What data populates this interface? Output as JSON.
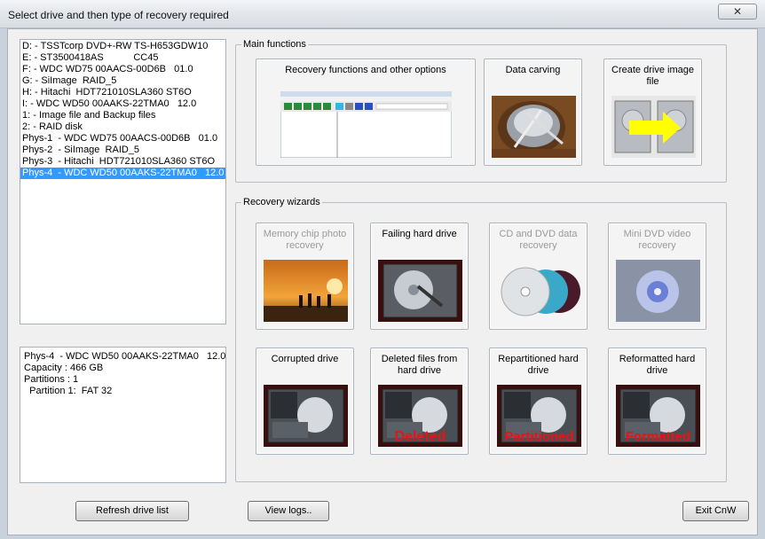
{
  "window": {
    "title": "Select drive and then type of recovery required",
    "close_glyph": "✕"
  },
  "drives": [
    "D: - TSSTcorp DVD+-RW TS-H653GDW10",
    "E: - ST3500418AS           CC45",
    "F: - WDC WD75 00AACS-00D6B   01.0",
    "G: - SiImage  RAID_5",
    "H: - Hitachi  HDT721010SLA360 ST6O",
    "I: - WDC WD50 00AAKS-22TMA0   12.0",
    "1: - Image file and Backup files",
    "2: - RAID disk",
    "Phys-1  - WDC WD75 00AACS-00D6B   01.0",
    "Phys-2  - SiImage  RAID_5",
    "Phys-3  - Hitachi  HDT721010SLA360 ST6O",
    "Phys-4  - WDC WD50 00AAKS-22TMA0   12.0"
  ],
  "selected_drive_index": 11,
  "drive_info": [
    "Phys-4  - WDC WD50 00AAKS-22TMA0   12.0",
    "Capacity : 466 GB",
    "Partitions : 1",
    "  Partition 1:  FAT 32"
  ],
  "main_functions": {
    "label": "Main functions",
    "recovery": "Recovery functions and other options",
    "carving": "Data carving",
    "image": "Create drive image file"
  },
  "wizards": {
    "label": "Recovery wizards",
    "memory": "Memory chip photo recovery",
    "failing": "Failing hard drive",
    "cd": "CD and DVD data recovery",
    "minidvd": "Mini DVD video recovery",
    "corrupted": "Corrupted drive",
    "deleted": "Deleted files from hard drive",
    "repartitioned": "Repartitioned hard drive",
    "reformatted": "Reformatted hard drive",
    "deleted_overlay": "Deleted",
    "partitioned_overlay": "Partitioned",
    "formatted_overlay": "Formatted"
  },
  "buttons": {
    "refresh": "Refresh drive list",
    "logs": "View logs..",
    "exit": "Exit CnW"
  },
  "colors": {
    "selection": "#3399ff",
    "overlay_red": "#e11",
    "arrow_yellow": "#ffff00"
  }
}
